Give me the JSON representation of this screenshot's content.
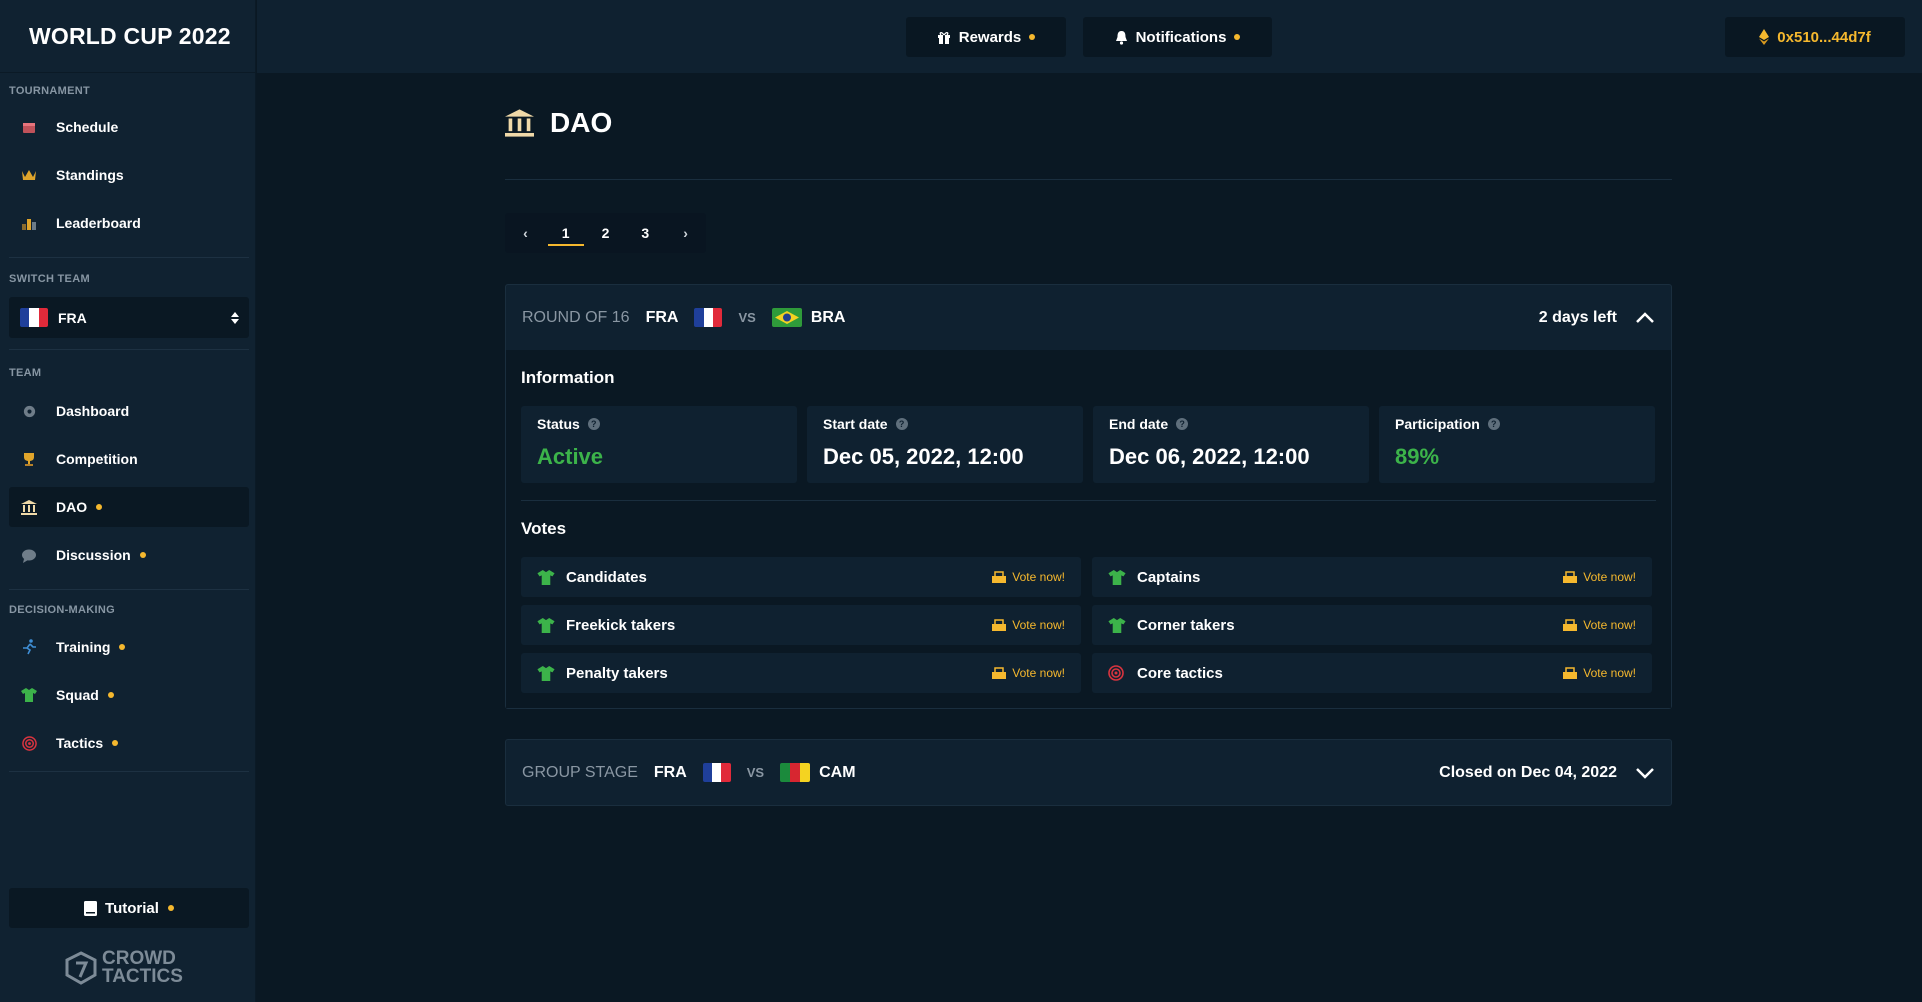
{
  "app": {
    "title": "WORLD CUP 2022",
    "logo_text_1": "CROWD",
    "logo_text_2": "TACTICS"
  },
  "sidebar": {
    "sections": {
      "tournament": "TOURNAMENT",
      "switch_team": "SWITCH TEAM",
      "team": "TEAM",
      "decision_making": "DECISION-MAKING"
    },
    "tournament_items": [
      {
        "label": "Schedule",
        "icon": "calendar-icon"
      },
      {
        "label": "Standings",
        "icon": "crown-icon"
      },
      {
        "label": "Leaderboard",
        "icon": "podium-icon"
      }
    ],
    "selected_team": "FRA",
    "team_items": [
      {
        "label": "Dashboard",
        "icon": "gear-icon"
      },
      {
        "label": "Competition",
        "icon": "trophy-icon"
      },
      {
        "label": "DAO",
        "icon": "bank-icon",
        "dot": true,
        "active": true
      },
      {
        "label": "Discussion",
        "icon": "chat-icon",
        "dot": true
      }
    ],
    "decision_items": [
      {
        "label": "Training",
        "icon": "runner-icon",
        "dot": true
      },
      {
        "label": "Squad",
        "icon": "shirt-icon",
        "dot": true
      },
      {
        "label": "Tactics",
        "icon": "target-icon",
        "dot": true
      }
    ],
    "tutorial": "Tutorial"
  },
  "topbar": {
    "rewards": "Rewards",
    "notifications": "Notifications",
    "wallet": "0x510...44d7f"
  },
  "page": {
    "title": "DAO",
    "pages": [
      "1",
      "2",
      "3"
    ],
    "current_page": "1",
    "prev": "‹",
    "next": "›"
  },
  "matches": [
    {
      "stage": "ROUND OF 16",
      "home": "FRA",
      "away": "BRA",
      "vs": "VS",
      "status_text": "2 days left",
      "expanded": true,
      "information_title": "Information",
      "info": [
        {
          "label": "Status",
          "value": "Active"
        },
        {
          "label": "Start date",
          "value": "Dec 05, 2022, 12:00"
        },
        {
          "label": "End date",
          "value": "Dec 06, 2022, 12:00"
        },
        {
          "label": "Participation",
          "value": "89%"
        }
      ],
      "votes_title": "Votes",
      "votes": [
        {
          "label": "Candidates",
          "icon": "shirt-icon",
          "cta": "Vote now!"
        },
        {
          "label": "Captains",
          "icon": "shirt-icon",
          "cta": "Vote now!"
        },
        {
          "label": "Freekick takers",
          "icon": "shirt-icon",
          "cta": "Vote now!"
        },
        {
          "label": "Corner takers",
          "icon": "shirt-icon",
          "cta": "Vote now!"
        },
        {
          "label": "Penalty takers",
          "icon": "shirt-icon",
          "cta": "Vote now!"
        },
        {
          "label": "Core tactics",
          "icon": "target-icon",
          "cta": "Vote now!"
        }
      ]
    },
    {
      "stage": "GROUP STAGE",
      "home": "FRA",
      "away": "CAM",
      "vs": "VS",
      "status_text": "Closed on Dec 04, 2022",
      "expanded": false
    }
  ],
  "colors": {
    "accent": "#f5b82e",
    "success": "#3cb34a",
    "background": "#0a1823",
    "panel": "#0f2130"
  }
}
